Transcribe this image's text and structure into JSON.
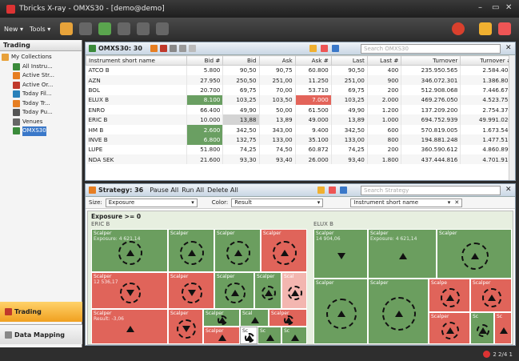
{
  "window": {
    "title": "Tbricks X-ray - OMXS30 - [demo@demo]"
  },
  "toolbar": {
    "new": "New",
    "tools": "Tools"
  },
  "sidebar": {
    "title": "Trading",
    "items": [
      {
        "label": "My Collections"
      },
      {
        "label": "All Instru..."
      },
      {
        "label": "Active Str..."
      },
      {
        "label": "Active Or..."
      },
      {
        "label": "Today Fil..."
      },
      {
        "label": "Today Tr..."
      },
      {
        "label": "Today Pu..."
      },
      {
        "label": "Venues"
      },
      {
        "label": "OMXS30"
      }
    ],
    "nav_trading": "Trading",
    "nav_mapping": "Data Mapping"
  },
  "instruments": {
    "title": "OMXS30: 30",
    "search_placeholder": "Search OMXS30",
    "columns": [
      "Instrument short name",
      "Bid #",
      "Bid",
      "Ask",
      "Ask #",
      "Last",
      "Last #",
      "Turnover",
      "Turnover #"
    ],
    "rows": [
      [
        "ATCO B",
        "5.800",
        "90,50",
        "90,75",
        "60.800",
        "90,50",
        "400",
        "235.950.565",
        "2.584.408"
      ],
      [
        "AZN",
        "27.950",
        "250,50",
        "251,00",
        "11.250",
        "251,00",
        "900",
        "346.072.301",
        "1.386.807"
      ],
      [
        "BOL",
        "20.700",
        "69,75",
        "70,00",
        "53.710",
        "69,75",
        "200",
        "512.908.068",
        "7.446.676"
      ],
      [
        "ELUX B",
        "8.100",
        "103,25",
        "103,50",
        "7.000",
        "103,25",
        "2.000",
        "469.276.050",
        "4.523.751"
      ],
      [
        "ENRO",
        "66.400",
        "49,90",
        "50,00",
        "61.500",
        "49,90",
        "1.200",
        "137.209.200",
        "2.754.376"
      ],
      [
        "ERIC B",
        "10.000",
        "13,88",
        "13,89",
        "49.000",
        "13,89",
        "1.000",
        "694.752.939",
        "49.991.020"
      ],
      [
        "HM B",
        "2.600",
        "342,50",
        "343,00",
        "9.400",
        "342,50",
        "600",
        "570.819.005",
        "1.673.546"
      ],
      [
        "INVE B",
        "6.800",
        "132,75",
        "133,00",
        "35.100",
        "133,00",
        "800",
        "194.881.248",
        "1.477.511"
      ],
      [
        "LUPE",
        "51.800",
        "74,25",
        "74,50",
        "60.872",
        "74,25",
        "200",
        "360.590.612",
        "4.860.899"
      ],
      [
        "NDA SEK",
        "21.600",
        "93,30",
        "93,40",
        "26.000",
        "93,40",
        "1.800",
        "437.444.816",
        "4.701.911"
      ]
    ]
  },
  "strategy": {
    "title": "Strategy: 36",
    "pause_all": "Pause All",
    "run_all": "Run All",
    "delete_all": "Delete All",
    "search_placeholder": "Search Strategy",
    "size_label": "Size:",
    "size_value": "Exposure",
    "color_label": "Color:",
    "color_value": "Result",
    "group_value": "Instrument short name",
    "filter_text": "Exposure >= 0",
    "group1": "ERIC B",
    "group2": "ELUX B",
    "tiles": {
      "scalper": "Scalper",
      "sc": "Sc",
      "scal": "Scal",
      "scalpe": "Scalpe",
      "t1": "Exposure: 4 621,14",
      "t2": "12 536,17",
      "t3": "Result: -3,06",
      "t4": "14 904,06"
    }
  },
  "status": {
    "text": "2   2/4   1"
  },
  "colors": {
    "green": "#6b9e5f",
    "red": "#e0645a",
    "accent": "#3a78c9"
  }
}
